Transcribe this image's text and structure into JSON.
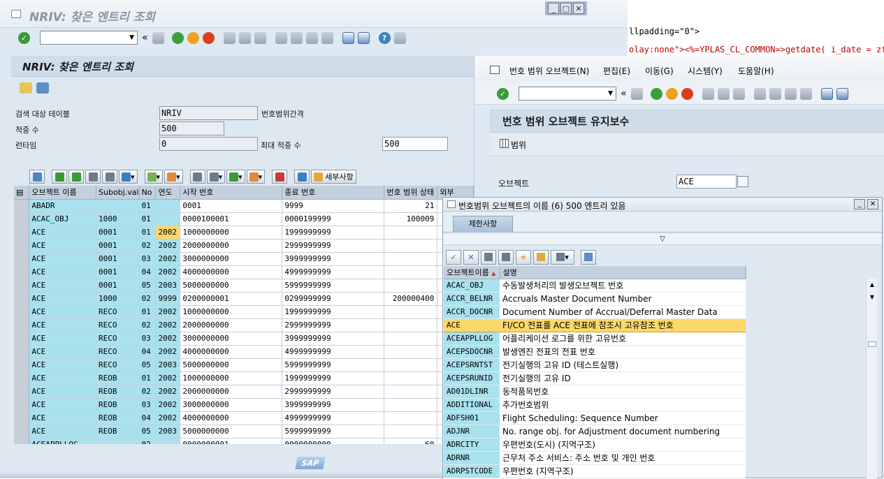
{
  "background_code": {
    "line1": "llpadding=\"0\">",
    "line2": "olay:none\"><%=YPLAS_CL_COMMON=>getdate( i_date = zfb"
  },
  "window1": {
    "title": "NRIV: 찾은 엔트리 조회",
    "header_title": "NRIV: 찾은 엔트리 조회",
    "fields": {
      "search_table_label": "검색 대상 테이블",
      "search_table_value": "NRIV",
      "search_table_desc": "번호범위간격",
      "hits_label": "적중 수",
      "hits_value": "500",
      "runtime_label": "런타임",
      "runtime_value": "0",
      "max_hits_label": "최대 적중 수",
      "max_hits_value": "500"
    },
    "alv_toolbar": {
      "details_label": "세부사항"
    },
    "grid": {
      "columns": [
        "오브젝트 이름",
        "Subobj.val",
        "No",
        "연도",
        "시작 번호",
        "종료 번호",
        "번호 범위 상태",
        "외부"
      ],
      "rows": [
        [
          "ABADR",
          "",
          "01",
          "",
          "0001",
          "9999",
          "21"
        ],
        [
          "ACAC_OBJ",
          "1000",
          "01",
          "",
          "0000100001",
          "0000199999",
          "100009"
        ],
        [
          "ACE",
          "0001",
          "01",
          "2002",
          "1000000000",
          "1999999999",
          ""
        ],
        [
          "ACE",
          "0001",
          "02",
          "2002",
          "2000000000",
          "2999999999",
          ""
        ],
        [
          "ACE",
          "0001",
          "03",
          "2002",
          "3000000000",
          "3999999999",
          ""
        ],
        [
          "ACE",
          "0001",
          "04",
          "2002",
          "4000000000",
          "4999999999",
          ""
        ],
        [
          "ACE",
          "0001",
          "05",
          "2003",
          "5000000000",
          "5999999999",
          ""
        ],
        [
          "ACE",
          "1000",
          "02",
          "9999",
          "0200000001",
          "0299999999",
          "200000400"
        ],
        [
          "ACE",
          "RECO",
          "01",
          "2002",
          "1000000000",
          "1999999999",
          ""
        ],
        [
          "ACE",
          "RECO",
          "02",
          "2002",
          "2000000000",
          "2999999999",
          ""
        ],
        [
          "ACE",
          "RECO",
          "03",
          "2002",
          "3000000000",
          "3999999999",
          ""
        ],
        [
          "ACE",
          "RECO",
          "04",
          "2002",
          "4000000000",
          "4999999999",
          ""
        ],
        [
          "ACE",
          "RECO",
          "05",
          "2003",
          "5000000000",
          "5999999999",
          ""
        ],
        [
          "ACE",
          "REOB",
          "01",
          "2002",
          "1000000000",
          "1999999999",
          ""
        ],
        [
          "ACE",
          "REOB",
          "02",
          "2002",
          "2000000000",
          "2999999999",
          ""
        ],
        [
          "ACE",
          "REOB",
          "03",
          "2002",
          "3000000000",
          "3999999999",
          ""
        ],
        [
          "ACE",
          "REOB",
          "04",
          "2002",
          "4000000000",
          "4999999999",
          ""
        ],
        [
          "ACE",
          "REOB",
          "05",
          "2003",
          "5000000000",
          "5999999999",
          ""
        ],
        [
          "ACEAPPLLOG",
          "",
          "02",
          "",
          "0000000001",
          "0000000000",
          "60"
        ]
      ]
    },
    "sap_logo": "SAP"
  },
  "window2": {
    "menu": [
      "번호 범위 오브젝트(N)",
      "편집(E)",
      "이동(G)",
      "시스템(Y)",
      "도움말(H)"
    ],
    "header_title": "번호 범위 오브젝트 유지보수",
    "ranges_button": "범위",
    "object_label": "오브젝트",
    "object_value": "ACE"
  },
  "popup": {
    "title": "번호범위 오브젝트의 이름 (6)  500 엔트리 있음",
    "tab": "제한사항",
    "columns": [
      "오브젝트이름",
      "설명"
    ],
    "rows": [
      [
        "ACAC_OBJ",
        "수동발생처리의 발생오브젝트 번호"
      ],
      [
        "ACCR_BELNR",
        "Accruals Master Document Number"
      ],
      [
        "ACCR_DOCNR",
        "Document Number of Accrual/Deferral Master Data"
      ],
      [
        "ACE",
        "FI/CO 전표를 ACE 전표에 참조시 고유참조 번호"
      ],
      [
        "ACEAPPLLOG",
        "어플리케이션 로그를 위한 고유번호"
      ],
      [
        "ACEPSDOCNR",
        "발생엔진 전표의 전표 번호"
      ],
      [
        "ACEPSRNTST",
        "전기실행의 고유 ID (테스트실행)"
      ],
      [
        "ACEPSRUNID",
        "전기실행의 고유 ID"
      ],
      [
        "AD01DLINR",
        "동적품목번호"
      ],
      [
        "ADDITIONAL",
        "추가번호범위"
      ],
      [
        "ADFSH01",
        "Flight Scheduling: Sequence Number"
      ],
      [
        "ADJNR",
        "No. range obj. for Adjustment document numbering"
      ],
      [
        "ADRCITY",
        "우편번호(도시) (지역구조)"
      ],
      [
        "ADRNR",
        "근무처 주소 서비스: 주소 번호 및 개인 번호"
      ],
      [
        "ADRPSTCODE",
        "우편번호 (지역구조)"
      ]
    ],
    "highlighted_row": 3
  }
}
